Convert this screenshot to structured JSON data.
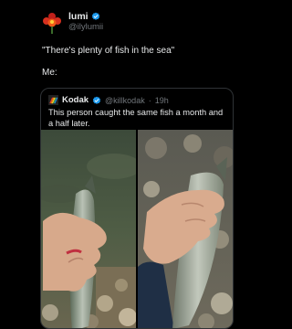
{
  "post": {
    "display_name": "lumi",
    "handle": "@ilylumii",
    "verified": true,
    "text_line1": "\"There's plenty of fish in the sea\"",
    "text_line2": "Me:"
  },
  "quote": {
    "display_name": "Kodak",
    "handle": "@killkodak",
    "time": "19h",
    "separator": "·",
    "verified": true,
    "text": "This person caught the same fish a month and a half later."
  },
  "colors": {
    "background": "#000000",
    "text": "#e7e9ea",
    "secondary_text": "#71767b",
    "verified_blue": "#1d9bf0",
    "border": "#2f3336"
  },
  "icons": {
    "author_avatar": "flower-avatar-icon",
    "verified": "verified-badge-icon",
    "quote_avatar": "rainbow-avatar-icon"
  }
}
